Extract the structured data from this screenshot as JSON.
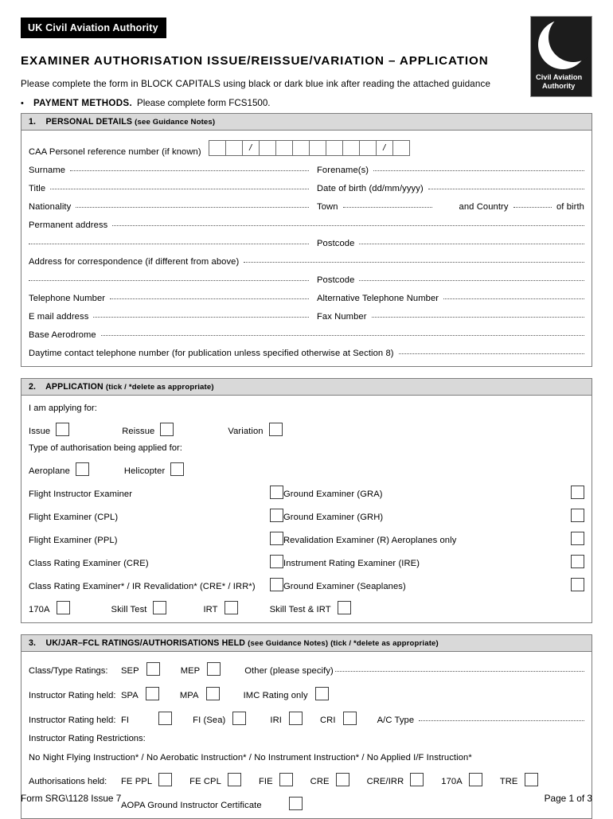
{
  "header": {
    "banner": "UK Civil Aviation Authority",
    "title": "EXAMINER  AUTHORISATION  ISSUE/REISSUE/VARIATION  –  APPLICATION",
    "instruction": "Please complete the form in BLOCK CAPITALS using black or dark blue ink after reading the attached guidance",
    "bullet_dot": "•",
    "bullet_strong": "PAYMENT METHODS.",
    "bullet_rest": "Please complete form FCS1500."
  },
  "logo": {
    "line1": "Civil Aviation",
    "line2": "Authority"
  },
  "section1": {
    "heading_number": "1.",
    "heading_title": "PERSONAL DETAILS",
    "heading_note": "(see Guidance Notes)",
    "ref_label": "CAA Personel reference number (if known)",
    "ref_boxes": [
      "",
      "",
      "/",
      "",
      "",
      "",
      "",
      "",
      "",
      "",
      "/",
      ""
    ],
    "surname_label": "Surname",
    "forenames_label": "Forename(s)",
    "title_label": "Title",
    "dob_label": "Date of birth (dd/mm/yyyy)",
    "nationality_label": "Nationality",
    "town_label": "Town",
    "and_country_label": "and Country",
    "of_birth_label": "of birth",
    "permanent_address_label": "Permanent  address",
    "postcode_label": "Postcode",
    "correspondence_label": "Address for correspondence (if different from above)",
    "postcode_label2": "Postcode",
    "telephone_label": "Telephone Number",
    "alt_telephone_label": "Alternative Telephone Number",
    "email_label": "E mail address",
    "fax_label": "Fax Number",
    "base_aerodrome_label": "Base  Aerodrome",
    "daytime_label": "Daytime contact telephone number (for publication unless specified otherwise at Section 8)"
  },
  "section2": {
    "heading_number": "2.",
    "heading_title": "APPLICATION",
    "heading_note": "(tick / *delete as appropriate)",
    "applying_for_label": "I am applying for:",
    "apply_options": [
      "Issue",
      "Reissue",
      "Variation"
    ],
    "type_label": "Type of authorisation being applied for:",
    "type_options": [
      "Aeroplane",
      "Helicopter"
    ],
    "examiners_left": [
      "Flight Instructor Examiner",
      "Flight Examiner (CPL)",
      "Flight Examiner (PPL)",
      "Class Rating Examiner (CRE)",
      "Class Rating Examiner* / IR Revalidation* (CRE* / IRR*)"
    ],
    "examiners_right": [
      "Ground Examiner (GRA)",
      "Ground Examiner (GRH)",
      "Revalidation Examiner (R)  Aeroplanes only",
      "Instrument Rating Examiner (IRE)",
      "Ground Examiner (Seaplanes)"
    ],
    "tail_options": [
      "170A",
      "Skill Test",
      "IRT",
      "Skill Test & IRT"
    ]
  },
  "section3": {
    "heading_number": "3.",
    "heading_title": "UK/JAR–FCL RATINGS/AUTHORISATIONS HELD",
    "heading_note": "(see Guidance Notes) (tick / *delete as appropriate)",
    "class_type_label": "Class/Type Ratings:",
    "class_type_options": [
      "SEP",
      "MEP"
    ],
    "other_label": "Other (please specify)",
    "instructor_label_1": "Instructor Rating held:",
    "instructor_options_1": [
      "SPA",
      "MPA",
      "IMC Rating only"
    ],
    "instructor_label_2": "Instructor Rating held:",
    "instructor_options_2": [
      "FI",
      "FI (Sea)",
      "IRI",
      "CRI"
    ],
    "ac_type_label": "A/C Type",
    "restrictions_label": "Instructor Rating Restrictions:",
    "restrictions_text": "No Night Flying Instruction* / No Aerobatic Instruction* / No Instrument Instruction* / No Applied I/F Instruction*",
    "authorisations_label": "Authorisations held:",
    "authorisations_options": [
      "FE PPL",
      "FE CPL",
      "FIE",
      "CRE",
      "CRE/IRR",
      "170A",
      "TRE"
    ],
    "aopa_label": "AOPA Ground Instructor Certificate"
  },
  "footer": {
    "form_id": "Form SRG\\1128 Issue 7",
    "page": "Page 1 of 3"
  }
}
